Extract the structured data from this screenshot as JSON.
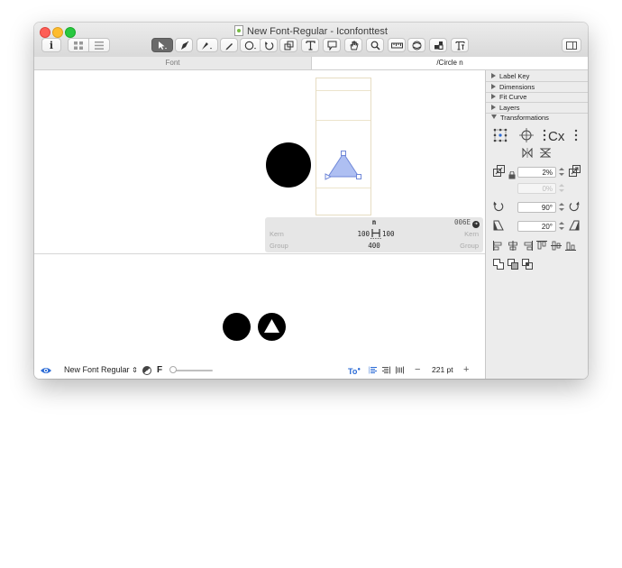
{
  "window": {
    "title": "New Font-Regular - Iconfonttest"
  },
  "toolbar": {
    "info_label": "i",
    "tools": [
      "select-tool",
      "draw-tool",
      "pen-tool",
      "pencil-tool",
      "shapes-tool",
      "rotate-tool",
      "scale-tool",
      "text-tool",
      "annotation-tool",
      "hand-tool",
      "zoom-tool",
      "measure-tool",
      "knife-tool",
      "components-tool",
      "type-tool"
    ]
  },
  "tabs": {
    "font": "Font",
    "glyph": "/Circle n"
  },
  "info_panel": {
    "glyph_name": "n",
    "unicode": "006E",
    "kern_left_label": "Kern",
    "kern_right_label": "Kern",
    "lsb": "100",
    "rsb": "100",
    "group_left_label": "Group",
    "group_right_label": "Group",
    "width": "400"
  },
  "bottom_bar": {
    "font_name": "New Font Regular",
    "f_label": "F",
    "to_label": "To",
    "zoom_value": "221 pt",
    "minus": "−",
    "plus": "+"
  },
  "sidebar": {
    "sections": [
      {
        "label": "Label Key",
        "expanded": false
      },
      {
        "label": "Dimensions",
        "expanded": false
      },
      {
        "label": "Fit Curve",
        "expanded": false
      },
      {
        "label": "Layers",
        "expanded": false
      },
      {
        "label": "Transformations",
        "expanded": true
      }
    ],
    "transformations": {
      "scale_value": "2%",
      "scale_y_value": "0%",
      "rotate_value": "90°",
      "skew_value": "20°"
    }
  },
  "colors": {
    "accent": "#2b6bd6",
    "triangle_fill": "#aebff2",
    "triangle_stroke": "#6f87d8",
    "metric_line": "#e6dcc2"
  }
}
